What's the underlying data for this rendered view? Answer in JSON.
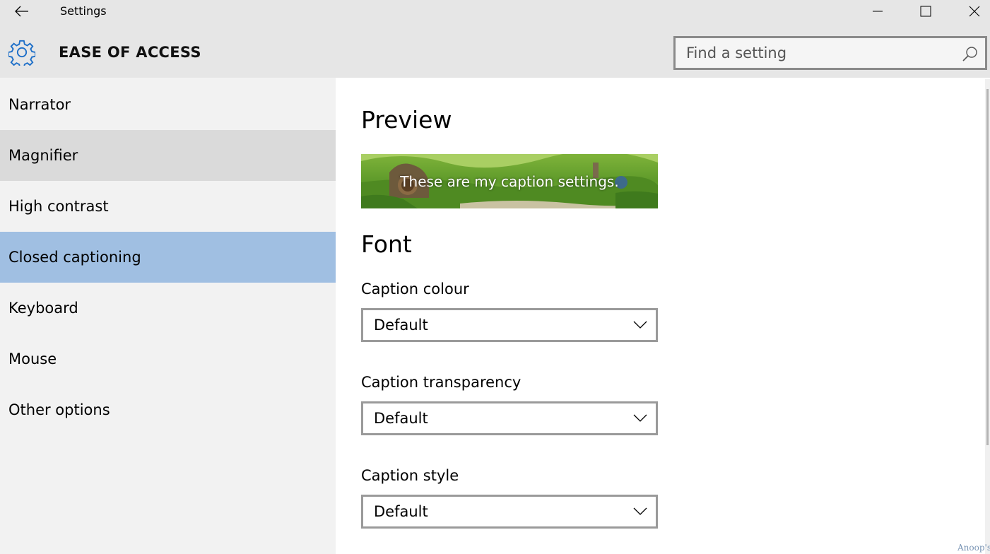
{
  "window": {
    "title": "Settings",
    "back_icon": "arrow-left-icon",
    "controls": [
      "minimize-icon",
      "maximize-icon",
      "close-icon"
    ]
  },
  "header": {
    "icon": "gear-icon",
    "title": "EASE OF ACCESS",
    "search": {
      "placeholder": "Find a setting",
      "value": "",
      "icon": "search-icon"
    }
  },
  "sidebar": {
    "items": [
      {
        "label": "Narrator",
        "state": "normal"
      },
      {
        "label": "Magnifier",
        "state": "hover"
      },
      {
        "label": "High contrast",
        "state": "normal"
      },
      {
        "label": "Closed captioning",
        "state": "selected"
      },
      {
        "label": "Keyboard",
        "state": "normal"
      },
      {
        "label": "Mouse",
        "state": "normal"
      },
      {
        "label": "Other options",
        "state": "normal"
      }
    ]
  },
  "main": {
    "preview_heading": "Preview",
    "preview_caption": "These are my caption settings.",
    "font_heading": "Font",
    "settings": [
      {
        "label": "Caption colour",
        "value": "Default"
      },
      {
        "label": "Caption transparency",
        "value": "Default"
      },
      {
        "label": "Caption style",
        "value": "Default"
      }
    ]
  },
  "colors": {
    "chrome": "#e6e6e6",
    "sidebar": "#f2f2f2",
    "selected": "#a0bfe2",
    "hover": "#dadada",
    "accent": "#1e6fc8"
  },
  "watermark": "Anoop's"
}
